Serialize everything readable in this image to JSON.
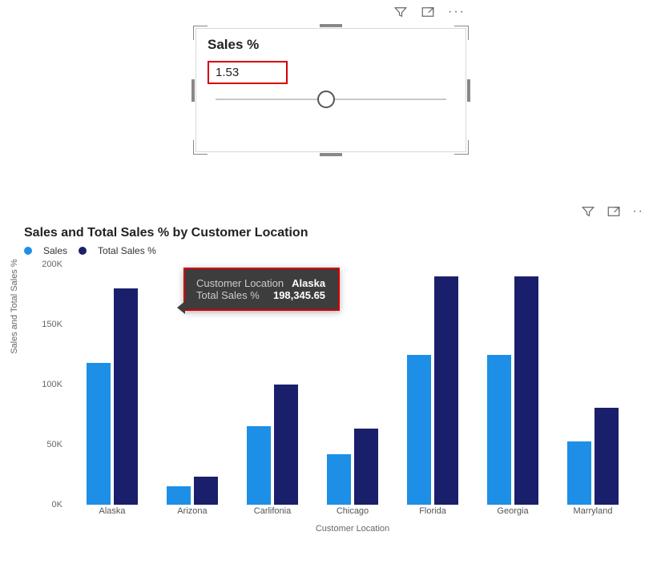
{
  "slicer": {
    "title": "Sales %",
    "value": "1.53"
  },
  "icons": {
    "filter": "filter-icon",
    "focus": "focus-mode-icon",
    "more": "more-options-icon"
  },
  "chart_title": "Sales and Total Sales % by Customer Location",
  "legend": {
    "sales": "Sales",
    "total": "Total Sales %"
  },
  "axes": {
    "y_label": "Sales and Total Sales %",
    "x_label": "Customer Location",
    "y_ticks": [
      "0K",
      "50K",
      "100K",
      "150K",
      "200K"
    ]
  },
  "tooltip": {
    "label1": "Customer Location",
    "value1": "Alaska",
    "label2": "Total Sales %",
    "value2": "198,345.65"
  },
  "chart_data": {
    "type": "bar",
    "title": "Sales and Total Sales % by Customer Location",
    "xlabel": "Customer Location",
    "ylabel": "Sales and Total Sales %",
    "ylim": [
      0,
      220000
    ],
    "categories": [
      "Alaska",
      "Arizona",
      "Carlifonia",
      "Chicago",
      "Florida",
      "Georgia",
      "Marryland"
    ],
    "series": [
      {
        "name": "Sales",
        "values": [
          130000,
          17000,
          72000,
          46000,
          137000,
          137000,
          58000
        ]
      },
      {
        "name": "Total Sales %",
        "values": [
          198345.65,
          26000,
          110000,
          70000,
          209000,
          209000,
          89000
        ]
      }
    ]
  }
}
